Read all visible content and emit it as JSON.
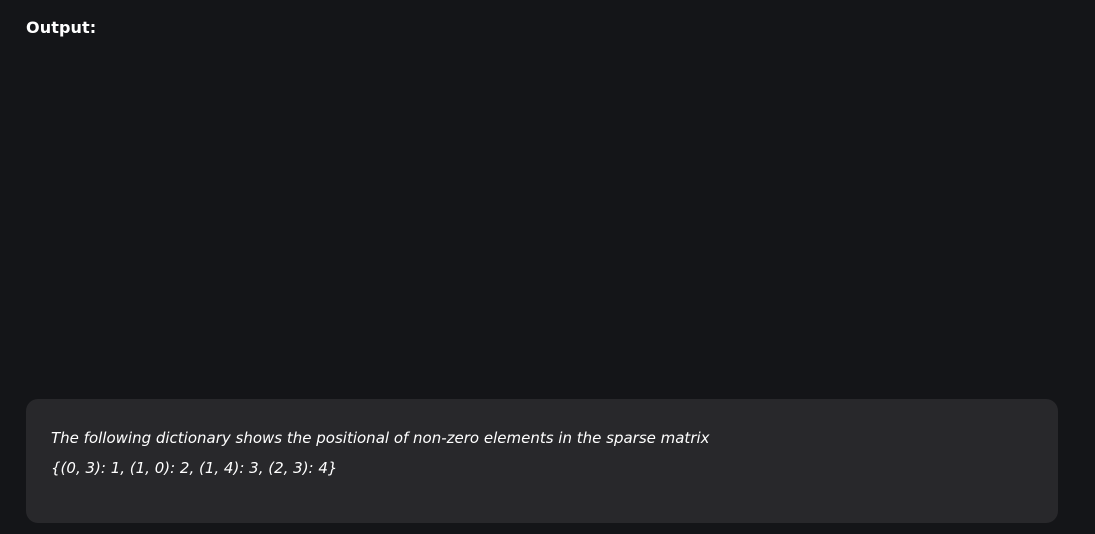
{
  "section": {
    "label": "Output:"
  },
  "output": {
    "lines": [
      "The following dictionary shows the positional of non-zero elements in the sparse matrix",
      "{(0, 3): 1, (1, 0): 2, (1, 4): 3, (2, 3): 4}"
    ]
  }
}
